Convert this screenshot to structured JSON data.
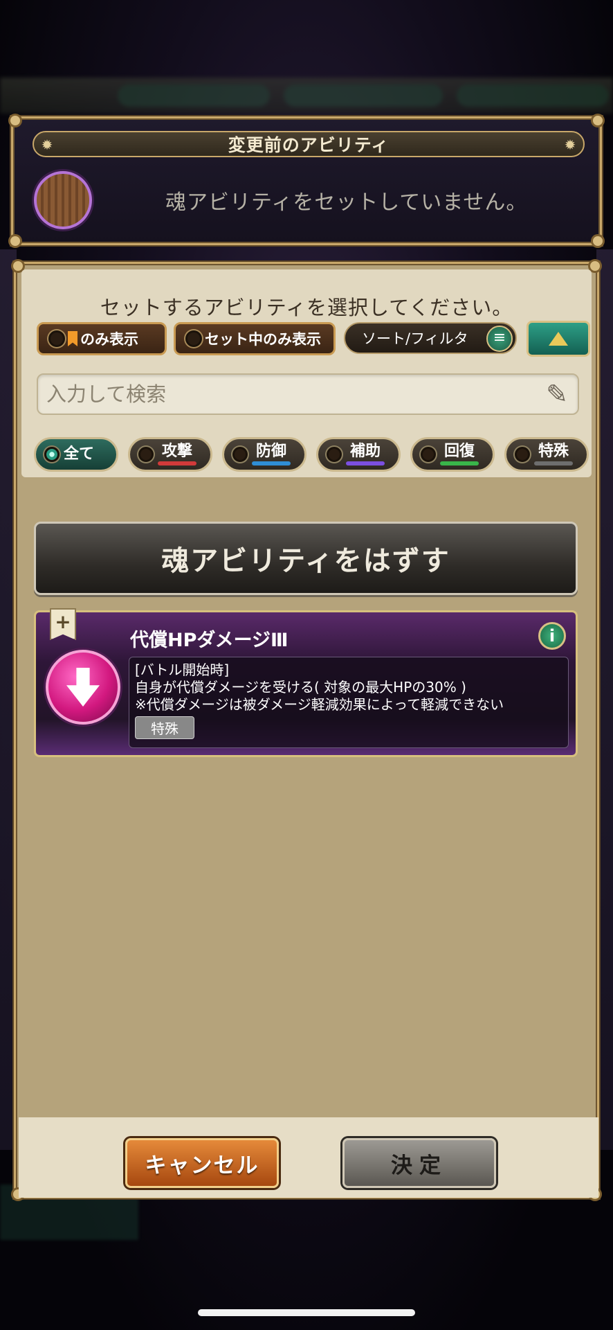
{
  "previous_ability": {
    "header": "変更前のアビリティ",
    "empty_text": "魂アビリティをセットしていません。"
  },
  "select": {
    "instruction": "セットするアビリティを選択してください。",
    "toggle_bookmark_only": "のみ表示",
    "toggle_set_only": "セット中のみ表示",
    "sort_filter": "ソート/フィルタ",
    "search_placeholder": "入力して検索",
    "categories": [
      {
        "label": "全て",
        "active": true,
        "color": ""
      },
      {
        "label": "攻撃",
        "active": false,
        "color": "#d23a3a"
      },
      {
        "label": "防御",
        "active": false,
        "color": "#2f8ed6"
      },
      {
        "label": "補助",
        "active": false,
        "color": "#7b4fe0"
      },
      {
        "label": "回復",
        "active": false,
        "color": "#39b54a"
      },
      {
        "label": "特殊",
        "active": false,
        "color": "#6e6e6e"
      }
    ]
  },
  "remove_button": "魂アビリティをはずす",
  "ability": {
    "name": "代償HPダメージⅢ",
    "desc1": "[バトル開始時]",
    "desc2": "自身が代償ダメージを受ける( 対象の最大HPの30% )",
    "desc3": "※代償ダメージは被ダメージ軽減効果によって軽減できない",
    "tag": "特殊"
  },
  "footer": {
    "cancel": "キャンセル",
    "confirm": "決定"
  }
}
